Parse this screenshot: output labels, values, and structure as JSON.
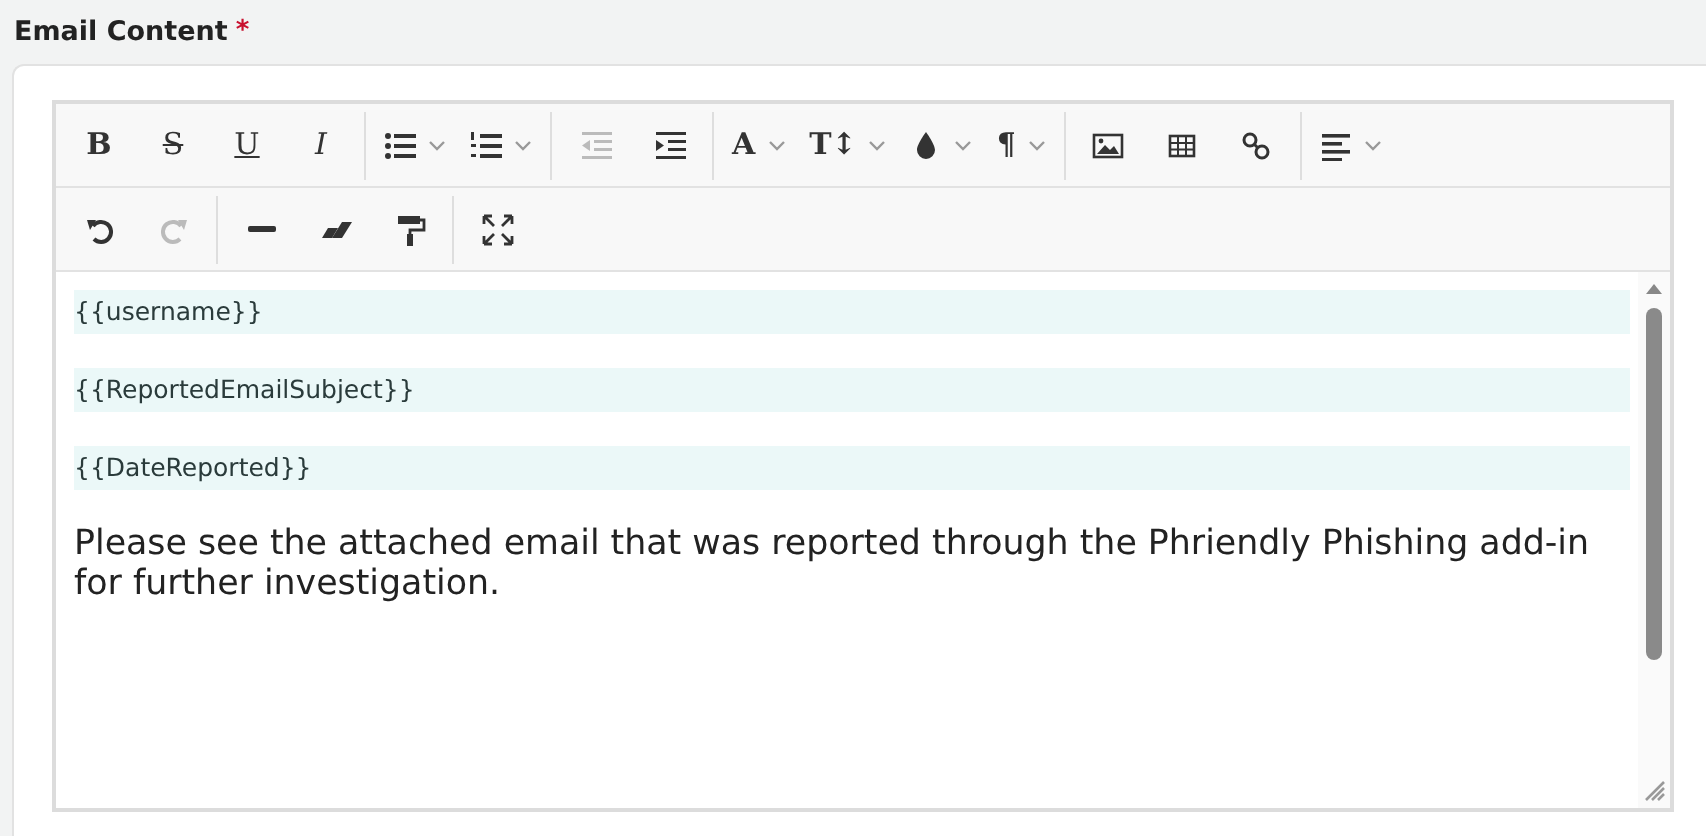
{
  "field": {
    "label": "Email Content",
    "required_mark": "*"
  },
  "toolbar": [
    [
      [
        {
          "kind": "bold",
          "label": "B"
        },
        {
          "kind": "strike",
          "label": "S"
        },
        {
          "kind": "underline",
          "label": "U"
        },
        {
          "kind": "italic",
          "label": "I"
        }
      ],
      [
        {
          "kind": "bullets",
          "dropdown": true
        },
        {
          "kind": "numbers",
          "dropdown": true
        }
      ],
      [
        {
          "kind": "outdent",
          "disabled": true
        },
        {
          "kind": "indent",
          "disabled": false
        }
      ],
      [
        {
          "kind": "fontcolor",
          "label": "A",
          "dropdown": true
        },
        {
          "kind": "fontsize",
          "label": "T↕",
          "dropdown": true
        },
        {
          "kind": "drop",
          "dropdown": true
        },
        {
          "kind": "paragraph",
          "label": "¶",
          "dropdown": true
        }
      ],
      [
        {
          "kind": "image"
        },
        {
          "kind": "table"
        },
        {
          "kind": "link"
        }
      ],
      [
        {
          "kind": "align",
          "dropdown": true
        }
      ]
    ],
    [
      [
        {
          "kind": "undo",
          "disabled": false
        },
        {
          "kind": "redo",
          "disabled": true
        }
      ],
      [
        {
          "kind": "rule"
        },
        {
          "kind": "eraser"
        },
        {
          "kind": "painter"
        }
      ],
      [
        {
          "kind": "fullscreen"
        }
      ]
    ]
  ],
  "content": [
    {
      "kind": "variable",
      "text": "{{username}}",
      "highlighted": true
    },
    {
      "kind": "variable",
      "text": "{{ReportedEmailSubject}}",
      "highlighted": true
    },
    {
      "kind": "variable",
      "text": "{{DateReported}}",
      "highlighted": true
    },
    {
      "kind": "paragraph",
      "text": "Please see the attached email that was reported through the Phriendly Phishing add-in for further investigation.",
      "highlighted": false
    }
  ]
}
